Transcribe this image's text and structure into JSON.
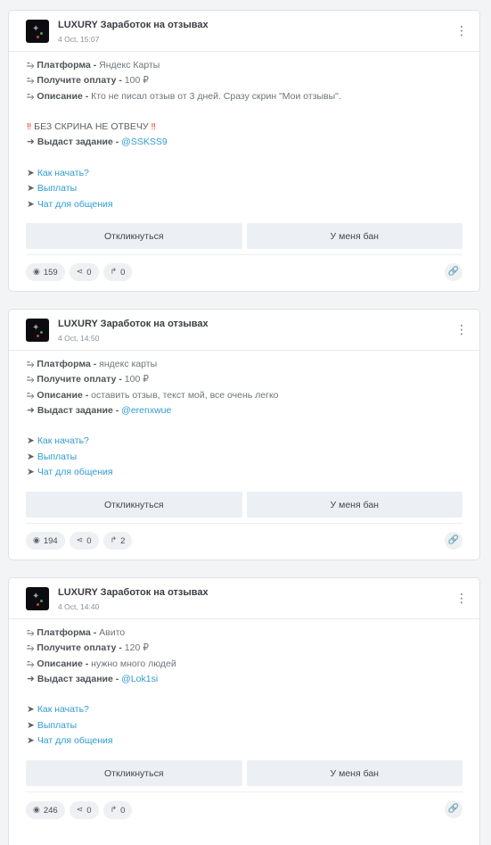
{
  "posts": [
    {
      "channel_name": "LUXURY Заработок на отзывах",
      "date": "4 Oct, 15:07",
      "menu_icon": "⋮",
      "arrow": "⥲",
      "platform_label": "Платформа -",
      "platform_value": "Яндекс Карты",
      "payment_label": "Получите оплату -",
      "payment_value": "100 ₽",
      "description_label": "Описание -",
      "description_value": "Кто не писал отзыв от 3 дней. Сразу скрин \"Мои отзывы\".",
      "warning": "БЕЗ СКРИНА НЕ ОТВЕЧУ",
      "task_label": "Выдаст задание -",
      "task_contact": "@SSKSS9",
      "links": [
        "Как начать?",
        "Выплаты",
        "Чат для общения"
      ],
      "respond_button": "Откликнуться",
      "ban_button": "У меня бан",
      "views": "159",
      "shares": "0",
      "forwards": "0"
    },
    {
      "channel_name": "LUXURY Заработок на отзывах",
      "date": "4 Oct, 14:50",
      "menu_icon": "⋮",
      "arrow": "⥲",
      "platform_label": "Платформа -",
      "platform_value": "яндекс карты",
      "payment_label": "Получите оплату -",
      "payment_value": "100 ₽",
      "description_label": "Описание -",
      "description_value": "оставить отзыв, текст мой, все очень легко",
      "task_label": "Выдаст задание -",
      "task_contact": "@erenxwue",
      "links": [
        "Как начать?",
        "Выплаты",
        "Чат для общения"
      ],
      "respond_button": "Откликнуться",
      "ban_button": "У меня бан",
      "views": "194",
      "shares": "0",
      "forwards": "2"
    },
    {
      "channel_name": "LUXURY Заработок на отзывах",
      "date": "4 Oct, 14:40",
      "menu_icon": "⋮",
      "arrow": "⥲",
      "platform_label": "Платформа -",
      "platform_value": "Авито",
      "payment_label": "Получите оплату -",
      "payment_value": "120 ₽",
      "description_label": "Описание -",
      "description_value": "нужно много людей",
      "task_label": "Выдаст задание -",
      "task_contact": "@Lok1si",
      "links": [
        "Как начать?",
        "Выплаты",
        "Чат для общения"
      ],
      "respond_button": "Откликнуться",
      "ban_button": "У меня бан",
      "views": "246",
      "shares": "0",
      "forwards": "0"
    }
  ],
  "icons": {
    "eye": "◉",
    "share": "⋖",
    "forward": "↱",
    "link": "🔗",
    "exclamation": "‼",
    "task_arrow": "➜",
    "link_arrow": "➤"
  },
  "colors": {
    "link": "#2f9bd1",
    "warning": "#e53935",
    "button_bg": "#eceff3"
  }
}
